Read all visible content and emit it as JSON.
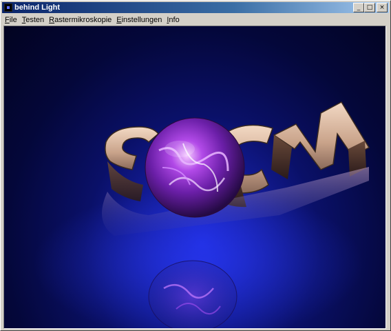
{
  "window": {
    "title": "behind Light",
    "controls": {
      "minimize": "_",
      "maximize": "□",
      "close": "×"
    }
  },
  "menubar": {
    "items": [
      {
        "accel": "F",
        "rest": "ile"
      },
      {
        "accel": "T",
        "rest": "esten"
      },
      {
        "accel": "R",
        "rest": "astermikroskopie"
      },
      {
        "accel": "E",
        "rest": "instellungen"
      },
      {
        "accel": "I",
        "rest": "nfo"
      }
    ]
  },
  "scene": {
    "text_3d": "SICM",
    "colors": {
      "background": "#04073a",
      "glow": "#1e2bd6",
      "letters": "#d9b59a",
      "orb": "#8a2be2"
    }
  }
}
